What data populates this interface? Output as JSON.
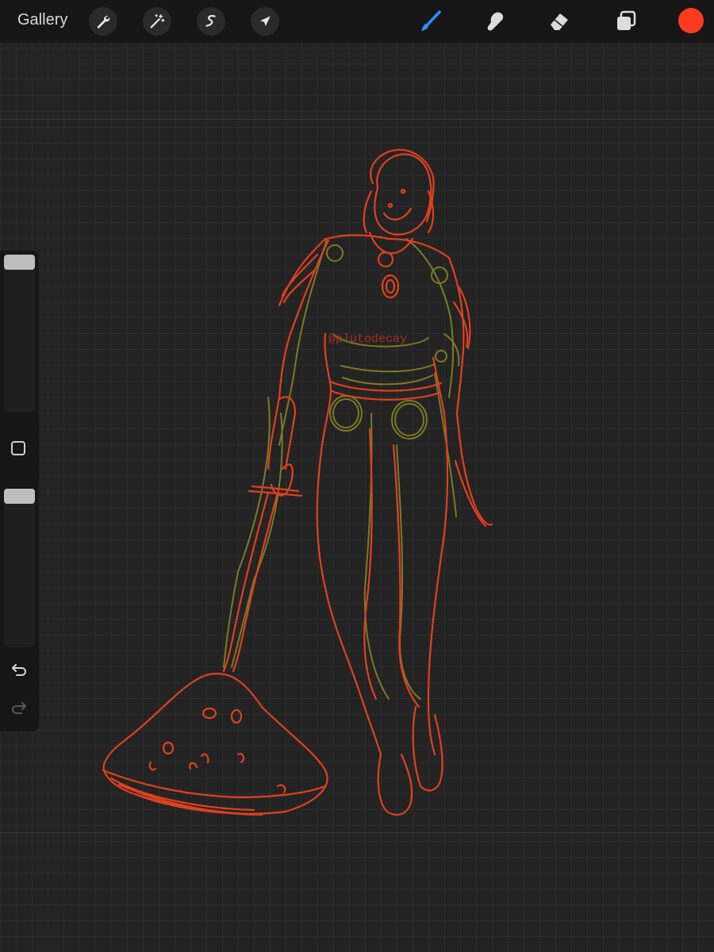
{
  "topbar": {
    "gallery_label": "Gallery",
    "left_tools": [
      "wrench-icon",
      "magic-wand-icon",
      "selection-icon",
      "transform-arrow-icon"
    ],
    "right_tools": [
      "brush-icon",
      "smudge-icon",
      "eraser-icon",
      "layers-icon"
    ],
    "active_tool": "brush-icon",
    "current_color": "#ff3b1f"
  },
  "sidebar": {
    "brush_size_level": 0.0,
    "opacity_level": 0.0,
    "icons": [
      "modify-square-icon",
      "undo-icon",
      "redo-icon"
    ]
  },
  "canvas": {
    "watermark": "@plutodecay",
    "stroke_colors": {
      "primary": "#e0401e",
      "sketch": "#7b7a25"
    }
  }
}
